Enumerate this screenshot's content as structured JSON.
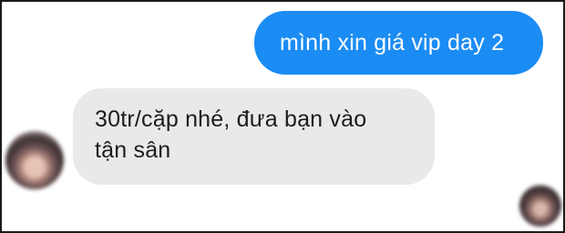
{
  "conversation": {
    "messages": [
      {
        "direction": "outgoing",
        "text": "mình xin giá vip day 2",
        "bubble_color": "#1b8cf3"
      },
      {
        "direction": "incoming",
        "text": "30tr/cặp nhé, đưa bạn vào\ntận sân",
        "bubble_color": "#e9e9eb"
      }
    ],
    "avatars": [
      {
        "owner": "sender",
        "icon": "blurred-profile-avatar"
      },
      {
        "owner": "receiver",
        "icon": "blurred-profile-avatar"
      }
    ]
  }
}
